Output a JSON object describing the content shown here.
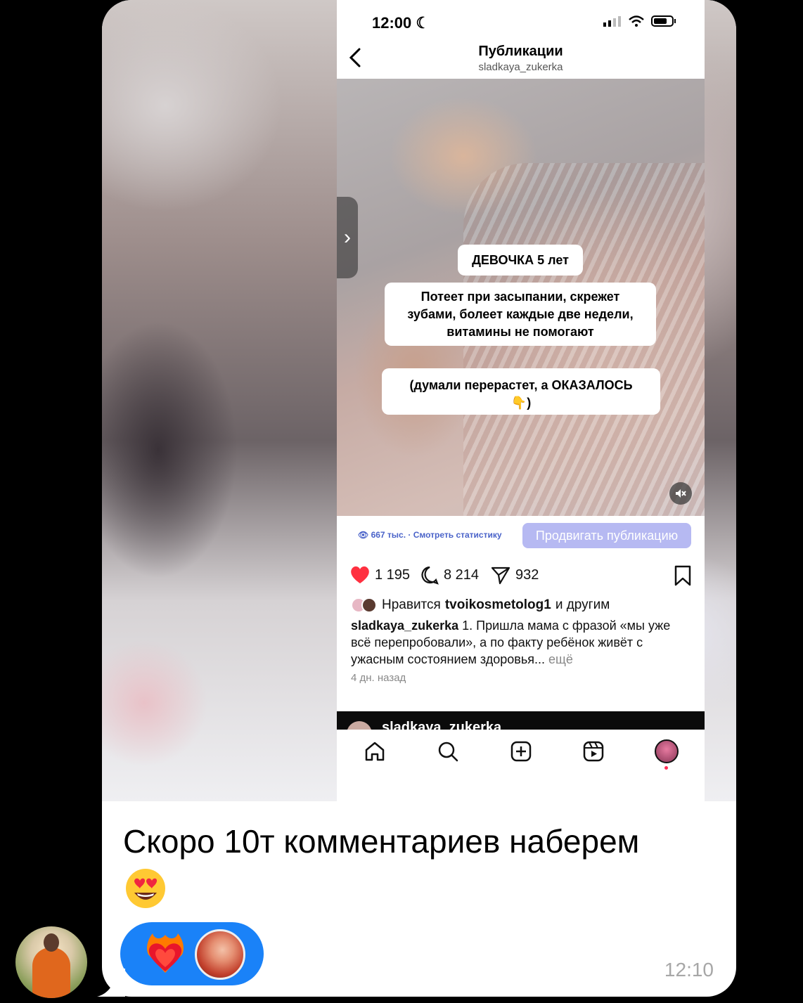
{
  "phone": {
    "status_time": "12:00",
    "header_title": "Публикации",
    "header_subtitle": "sladkaya_zukerka"
  },
  "post": {
    "overlay_title": "ДЕВОЧКА 5 лет",
    "overlay_line1": "Потеет при засыпании, скрежет",
    "overlay_line2": "зубами, болеет каждые две недели,",
    "overlay_line3": "витамины не помогают",
    "overlay_footer1": "(думали перерастет, а ОКАЗАЛОСЬ",
    "overlay_footer2": "👇)",
    "views": "667 тыс. · Смотреть статистику",
    "promote_label": "Продвигать публикацию",
    "likes": "1 195",
    "comments": "8 214",
    "shares": "932",
    "liked_by_prefix": "Нравится",
    "liked_by_user": "tvoikosmetolog1",
    "liked_by_suffix": "и другим",
    "caption_user": "sladkaya_zukerka",
    "caption_text": "1. Пришла мама с фразой «мы уже всё перепробовали», а по факту ребёнок живёт с ужасным состоянием здоровья...",
    "caption_more": "ещё",
    "time_ago": "4 дн. назад",
    "next_post_user": "sladkaya_zukerka"
  },
  "message": {
    "text": "Скоро 10т комментариев наберем",
    "emoji": "😍",
    "time": "12:10"
  },
  "icons": {
    "back": "chevron-left-icon",
    "home": "home-icon",
    "search": "search-icon",
    "create": "plus-square-icon",
    "reels": "reels-icon",
    "reaction": "heart-on-fire-icon"
  },
  "colors": {
    "reaction_pill": "#1a82f8",
    "promote_button": "#b6b9f2",
    "like_heart": "#ff3040"
  }
}
